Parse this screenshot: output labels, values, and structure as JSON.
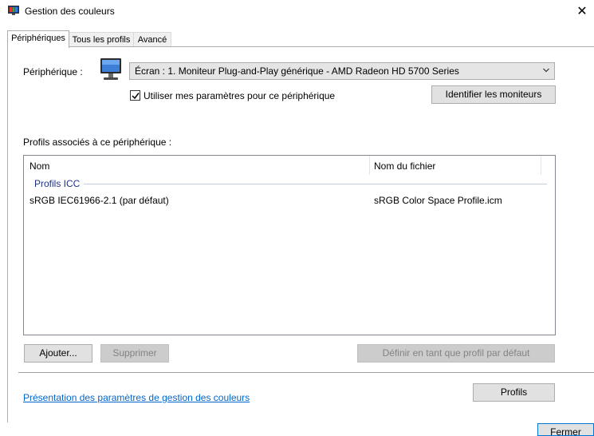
{
  "window": {
    "title": "Gestion des couleurs",
    "close_glyph": "✕"
  },
  "tabs": [
    {
      "label": "Périphériques",
      "active": true
    },
    {
      "label": "Tous les profils",
      "active": false
    },
    {
      "label": "Avancé",
      "active": false
    }
  ],
  "device": {
    "label": "Périphérique :",
    "selected": "Écran : 1. Moniteur Plug-and-Play générique - AMD Radeon HD 5700 Series",
    "use_settings_checkbox": {
      "label": "Utiliser mes paramètres pour ce périphérique",
      "checked": true
    },
    "identify_button": "Identifier les moniteurs"
  },
  "profiles": {
    "section_label": "Profils associés à ce périphérique :",
    "columns": [
      "Nom",
      "Nom du fichier"
    ],
    "group": "Profils ICC",
    "rows": [
      {
        "name": "sRGB IEC61966-2.1 (par défaut)",
        "file": "sRGB Color Space Profile.icm"
      }
    ]
  },
  "buttons": {
    "add": "Ajouter...",
    "remove": "Supprimer",
    "set_default": "Définir en tant que profil par défaut",
    "profiles": "Profils",
    "close": "Fermer"
  },
  "link": "Présentation des paramètres de gestion des couleurs",
  "icons": {
    "app": "color-management-icon",
    "monitor": "monitor-icon"
  },
  "colors": {
    "accent": "#0078d7",
    "link": "#0066cc",
    "group_header": "#1e3287"
  }
}
